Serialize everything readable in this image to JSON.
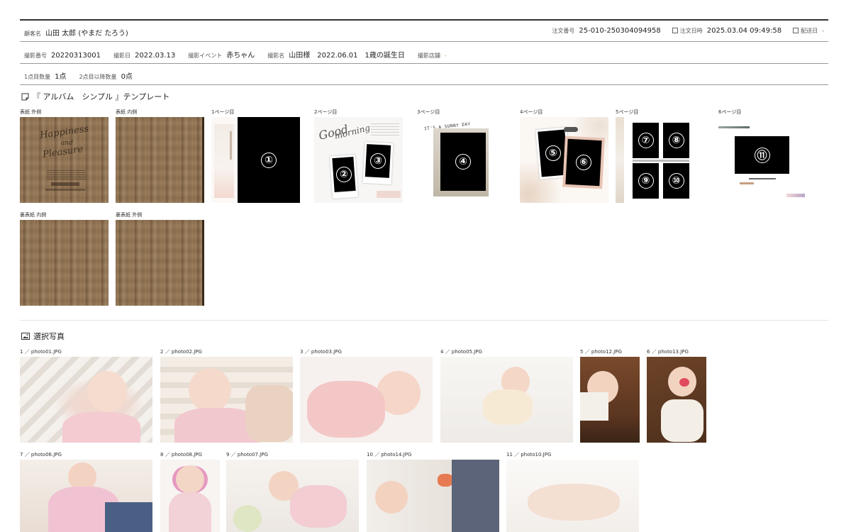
{
  "order": {
    "customer_label": "顧客名",
    "customer_value": "山田 太郎 (やまだ たろう)",
    "order_no_label": "注文番号",
    "order_no_value": "25-010-250304094958",
    "order_date_label": "注文日時",
    "order_date_value": "2025.03.04 09:49:58",
    "ship_date_label": "配送日",
    "ship_date_value": "-"
  },
  "shoot": {
    "shoot_no_label": "撮影番号",
    "shoot_no_value": "20220313001",
    "shoot_date_label": "撮影日",
    "shoot_date_value": "2022.03.13",
    "event_label": "撮影イベント",
    "event_value": "赤ちゃん",
    "name_label": "撮影名",
    "name_value_1": "山田様",
    "name_value_2": "2022.06.01",
    "name_value_3": "1歳の誕生日",
    "store_label": "撮影店舗",
    "store_value": "-"
  },
  "quantity": {
    "first_label": "1点目数量",
    "first_value": "1点",
    "second_label": "2点目以降数量",
    "second_value": "0点"
  },
  "template": {
    "title": "『 アルバム　シンプル 』テンプレート",
    "cover_outer_label": "表紙 外側",
    "cover_inner_label": "表紙 内側",
    "pages": [
      "1ページ目",
      "2ページ目",
      "3ページ目",
      "4ページ目",
      "5ページ目",
      "6ページ目"
    ],
    "back_inner_label": "裏表紙 内側",
    "back_outer_label": "裏表紙 外側",
    "cover_text_1": "Happiness",
    "cover_text_2": "and",
    "cover_text_3": "Pleasure",
    "page2_text_1": "Good",
    "page2_text_2": "morning",
    "page3_text": "IT'S A SUNNY DAY",
    "slot_numbers": [
      "①",
      "②",
      "③",
      "④",
      "⑤",
      "⑥",
      "⑦",
      "⑧",
      "⑨",
      "⑩",
      "⑪"
    ]
  },
  "selected": {
    "title": "選択写真",
    "photos": [
      {
        "caption": "1 ／ photo01.JPG"
      },
      {
        "caption": "2 ／ photo02.JPG"
      },
      {
        "caption": "3 ／ photo03.JPG"
      },
      {
        "caption": "4 ／ photo05.JPG"
      },
      {
        "caption": "5 ／ photo12.JPG"
      },
      {
        "caption": "6 ／ photo13.JPG"
      },
      {
        "caption": "7 ／ photo06.JPG"
      },
      {
        "caption": "8 ／ photo08.JPG"
      },
      {
        "caption": "9 ／ photo07.JPG"
      },
      {
        "caption": "10 ／ photo14.JPG"
      },
      {
        "caption": "11 ／ photo10.JPG"
      }
    ]
  },
  "colors": {
    "slot": "#000000",
    "wood": "#8a6c4c",
    "line": "#999999"
  }
}
